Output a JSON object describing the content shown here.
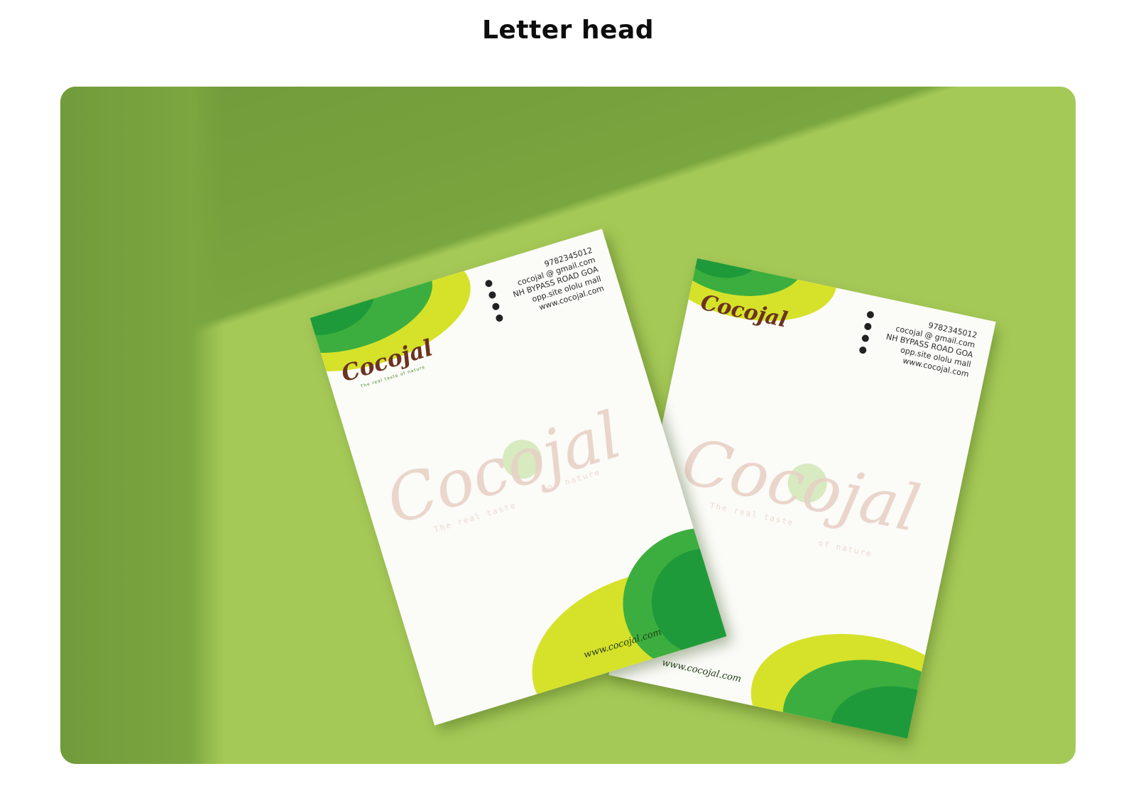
{
  "page": {
    "title": "Letter head"
  },
  "letterhead": {
    "brand": "Cocojal",
    "tagline": "The real taste of nature",
    "phone": "9782345012",
    "email": "cocojal @ gmail.com",
    "address_line1": "NH BYPASS ROAD GOA",
    "address_line2": "opp.site ololu mall",
    "website": "www.cocojal.com",
    "footer_url": "www.cocojal.com",
    "watermark_tag_left": "The real taste",
    "watermark_tag_right": "of nature"
  },
  "colors": {
    "background_green": "#a5c957",
    "shadow_green": "#6e9a3a",
    "dark_green": "#1f9a3a",
    "mid_green": "#3cae3f",
    "lime": "#d6e22a",
    "logo_brown": "#6b3320"
  },
  "icons": [
    "phone-icon",
    "email-icon",
    "location-icon",
    "globe-icon"
  ]
}
